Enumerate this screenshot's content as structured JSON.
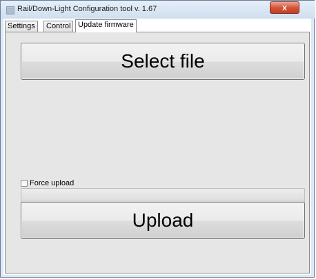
{
  "window": {
    "title": "Rail/Down-Light Configuration tool v. 1.67",
    "close_glyph": "x"
  },
  "tabs": [
    {
      "label": "Settings",
      "active": false
    },
    {
      "label": "Control",
      "active": false
    },
    {
      "label": "Update firmware",
      "active": true
    }
  ],
  "firmware": {
    "select_file_label": "Select file",
    "force_upload_label": "Force upload",
    "force_upload_checked": false,
    "progress": 0,
    "upload_label": "Upload"
  },
  "icons": {
    "app": "app-icon",
    "close": "close-icon"
  }
}
